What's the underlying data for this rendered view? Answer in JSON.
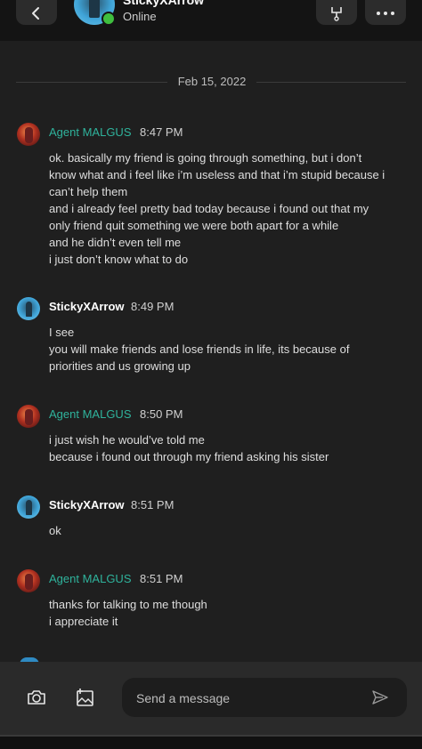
{
  "header": {
    "contact_name": "StickyXArrow",
    "status": "Online",
    "icons": {
      "back": "chevron-left-icon",
      "hub": "hub-icon",
      "more": "more-horizontal-icon"
    }
  },
  "date_separator": "Feb 15, 2022",
  "messages": [
    {
      "sender": "Agent MALGUS",
      "time": "8:47 PM",
      "lines": [
        "ok. basically my friend is going through something, but i don’t",
        "know what and i feel like i’m useless and that i’m stupid because i",
        "can’t help them",
        "and i already feel pretty bad today because i found out that my",
        "only friend quit something we were both apart for a while",
        "and he didn’t even tell me",
        "i just don’t know what to do"
      ]
    },
    {
      "sender": "StickyXArrow",
      "time": "8:49 PM",
      "lines": [
        "I see",
        "you will make friends and lose friends in life, its because of",
        "priorities and us growing up"
      ]
    },
    {
      "sender": "Agent MALGUS",
      "time": "8:50 PM",
      "lines": [
        "i just wish he would’ve told me",
        "because i found out through my friend asking his sister"
      ]
    },
    {
      "sender": "StickyXArrow",
      "time": "8:51 PM",
      "lines": [
        "ok"
      ]
    },
    {
      "sender": "Agent MALGUS",
      "time": "8:51 PM",
      "lines": [
        "thanks for talking to me though",
        "i appreciate it"
      ]
    }
  ],
  "composer": {
    "placeholder": "Send a message",
    "value": "",
    "icons": {
      "camera": "camera-icon",
      "image": "add-image-icon",
      "send": "send-icon"
    }
  },
  "colors": {
    "background": "#1f1f1f",
    "topbar": "#141414",
    "agent_name": "#2fb39c",
    "online": "#3fbf3f",
    "composer_bar": "#2a2a2a"
  }
}
